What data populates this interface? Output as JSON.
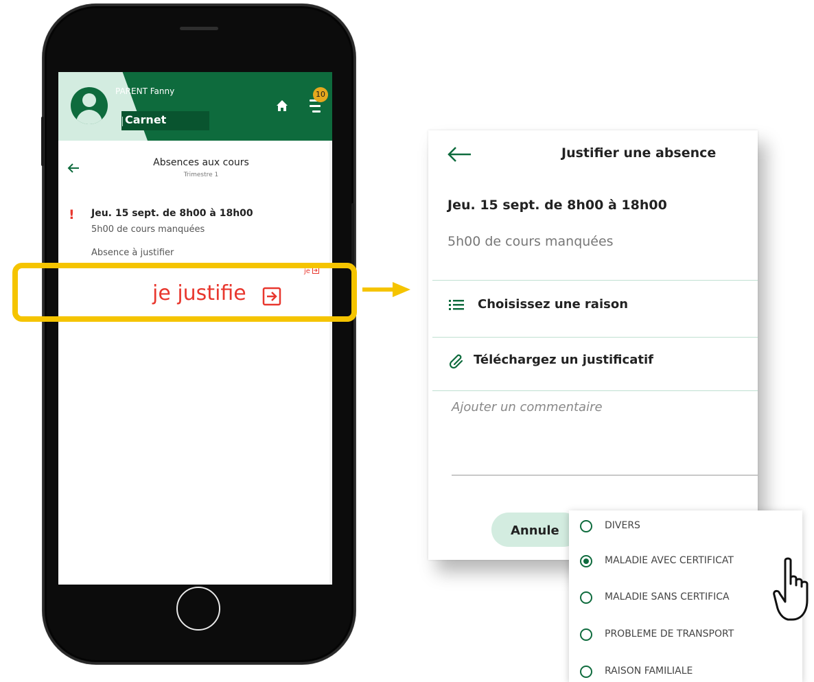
{
  "header": {
    "parent_name": "PARENT Fanny",
    "section": "Carnet",
    "badge_count": "10"
  },
  "absences": {
    "title": "Absences aux cours",
    "subtitle": "Trimestre 1",
    "item": {
      "alert": "!",
      "date": "Jeu. 15 sept. de 8h00 à 18h00",
      "hours": "5h00 de cours manquées",
      "status": "Absence à justifier",
      "action_small": "je"
    }
  },
  "callout": {
    "label": "je justifie"
  },
  "justify_panel": {
    "title": "Justifier une absence",
    "date": "Jeu. 15 sept. de 8h00 à 18h00",
    "hours": "5h00 de cours manquées",
    "reason_label": "Choisissez une raison",
    "upload_label": "Téléchargez un justificatif",
    "comment_placeholder": "Ajouter un commentaire",
    "cancel_label": "Annule"
  },
  "reasons": {
    "options": [
      {
        "label": "DIVERS",
        "selected": false
      },
      {
        "label": "MALADIE AVEC CERTIFICAT",
        "selected": true
      },
      {
        "label": "MALADIE SANS CERTIFICA",
        "selected": false
      },
      {
        "label": "PROBLEME DE TRANSPORT",
        "selected": false
      },
      {
        "label": "RAISON FAMILIALE",
        "selected": false
      }
    ]
  },
  "colors": {
    "brand_green": "#0e6b3d",
    "mint": "#d3ece0",
    "alert_red": "#e8372e",
    "highlight_yellow": "#f5c400",
    "badge_gold": "#e5a81e"
  },
  "icons": [
    "home-icon",
    "menu-icon",
    "back-arrow-icon",
    "list-icon",
    "paperclip-icon",
    "exit-arrow-icon",
    "pointer-hand-icon"
  ]
}
